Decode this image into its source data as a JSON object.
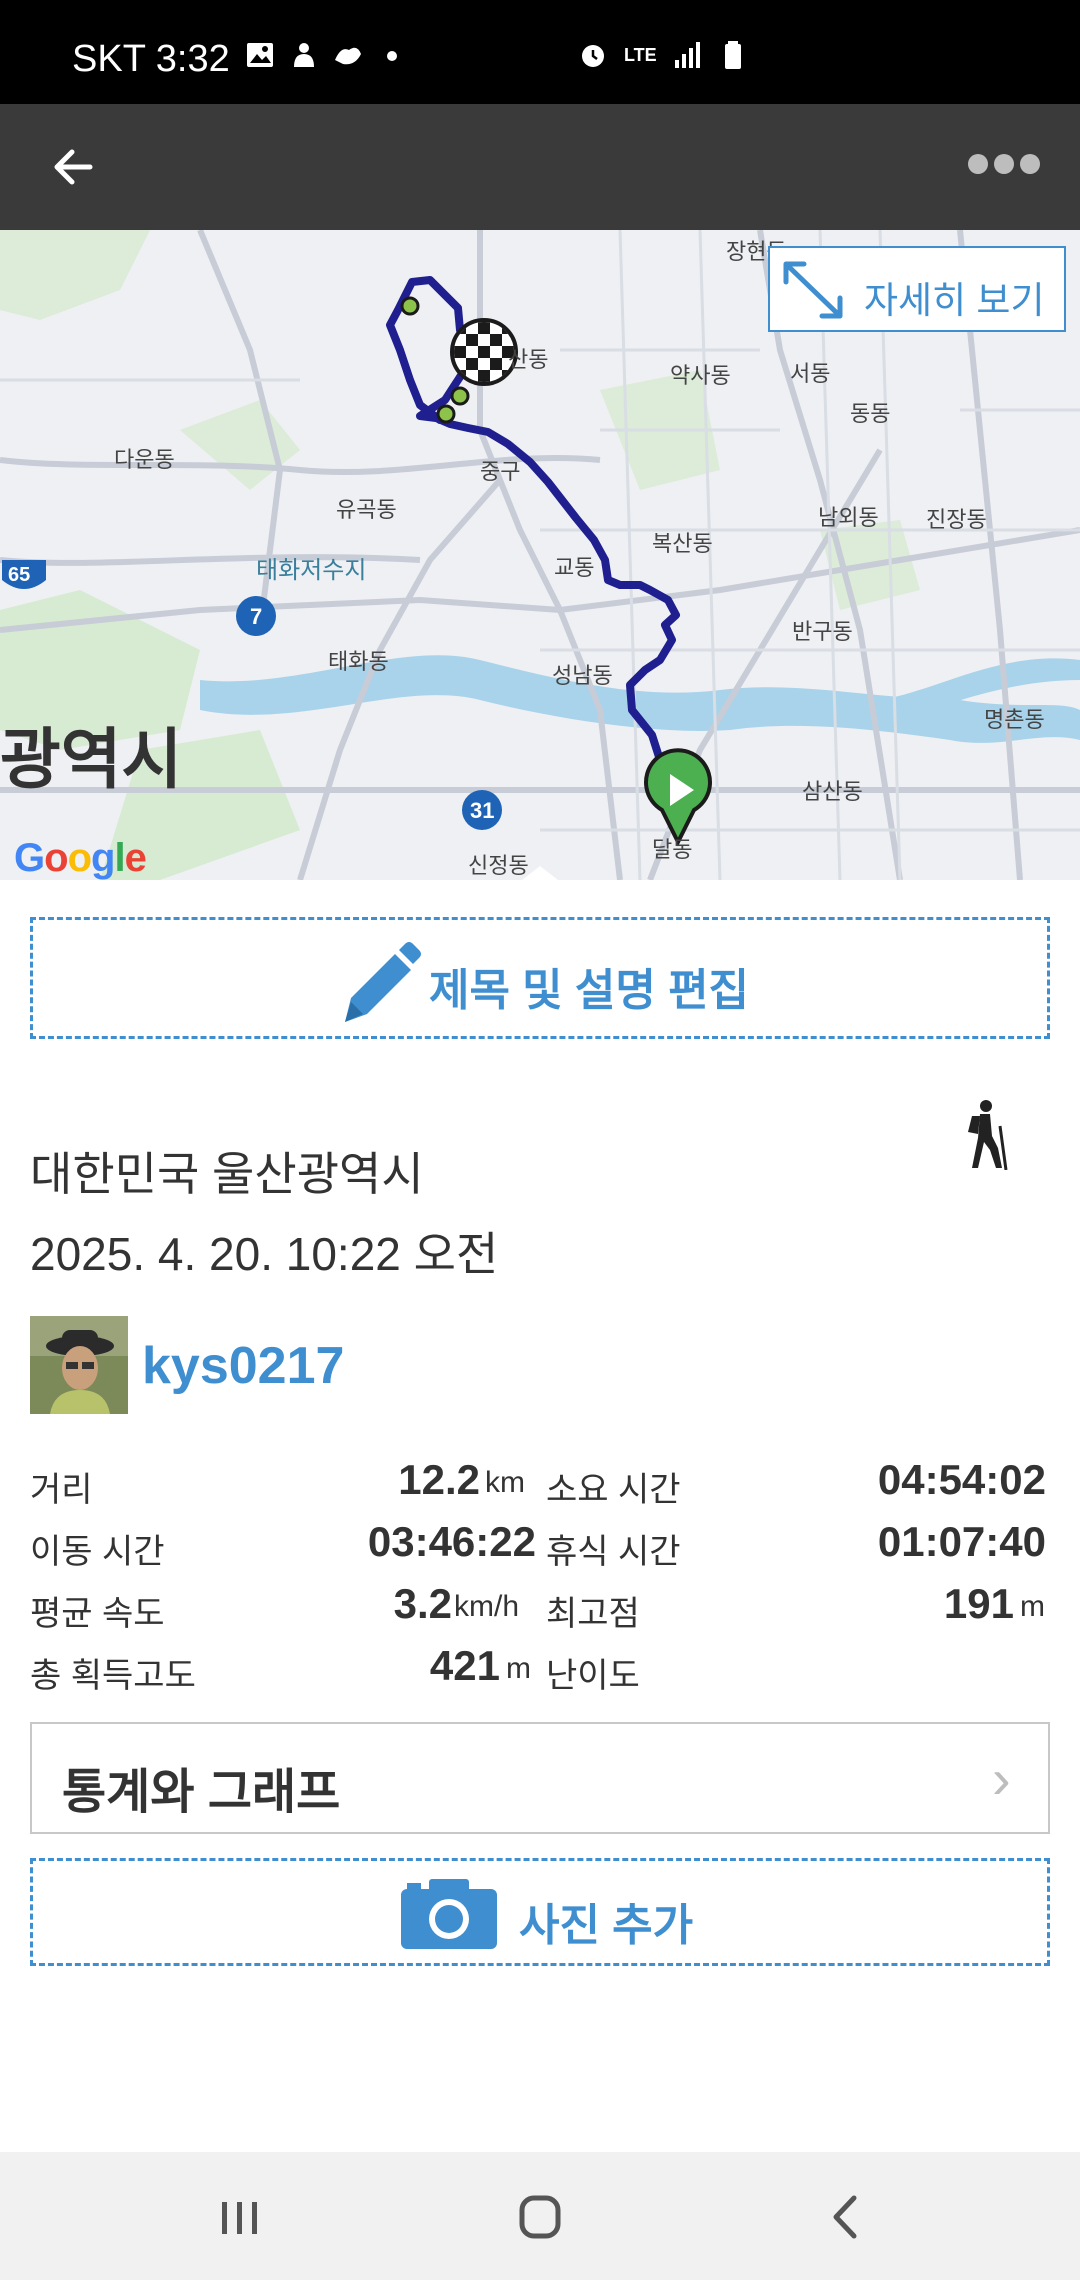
{
  "status_bar": {
    "carrier_time": "SKT 3:32",
    "network": "LTE",
    "left_icons": [
      "gallery-icon",
      "notification-icon",
      "notification-icon",
      "dot-icon"
    ],
    "right_icons": [
      "alarm-icon",
      "lte-icon",
      "signal-icon",
      "battery-icon"
    ]
  },
  "app_bar": {
    "back_icon": "arrow-left-icon",
    "more_icon": "more-dots-icon"
  },
  "map": {
    "detail_button_label": "자세히 보기",
    "google_logo": "Google",
    "big_label": "광역시",
    "labels": {
      "janghyeon": "장현동",
      "yaksa": "약사동",
      "seo": "서동",
      "dong": "동동",
      "sandong": "산동",
      "daun": "다운동",
      "junggu": "중구",
      "yugok": "유곡동",
      "reservoir": "태화저수지",
      "gyo": "교동",
      "boksan": "복산동",
      "namoe": "남외동",
      "jinjang": "진장동",
      "taehwa": "태화동",
      "seongnam": "성남동",
      "bangu": "반구동",
      "myeongchon": "명촌동",
      "samsan": "삼산동",
      "sinjeong": "신정동",
      "dal": "달동",
      "route65": "65",
      "route7": "7",
      "route31": "31"
    },
    "route_color": "#1f1f8f"
  },
  "edit_button": {
    "label": "제목 및 설명 편집",
    "icon": "pencil-icon"
  },
  "activity": {
    "location": "대한민국 울산광역시",
    "datetime": "2025. 4. 20. 10:22 오전",
    "username": "kys0217",
    "activity_icon": "hiking-icon"
  },
  "stats": {
    "distance_label": "거리",
    "distance_value": "12.2",
    "distance_unit": "km",
    "total_time_label": "소요 시간",
    "total_time_value": "04:54:02",
    "moving_time_label": "이동 시간",
    "moving_time_value": "03:46:22",
    "rest_time_label": "휴식 시간",
    "rest_time_value": "01:07:40",
    "avg_speed_label": "평균 속도",
    "avg_speed_value": "3.2",
    "avg_speed_unit": "km/h",
    "max_alt_label": "최고점",
    "max_alt_value": "191",
    "max_alt_unit": "m",
    "total_ascent_label": "총 획득고도",
    "total_ascent_value": "421",
    "total_ascent_unit": "m",
    "difficulty_label": "난이도"
  },
  "graph_button": {
    "label": "통계와 그래프",
    "chevron": "›"
  },
  "photo_button": {
    "label": "사진 추가",
    "icon": "camera-icon"
  },
  "nav_bar": {
    "icons": [
      "recent-apps-icon",
      "home-icon",
      "back-icon"
    ]
  },
  "colors": {
    "accent": "#3f8ecf",
    "app_bar": "#3a3a3a",
    "status_bar": "#000000"
  }
}
